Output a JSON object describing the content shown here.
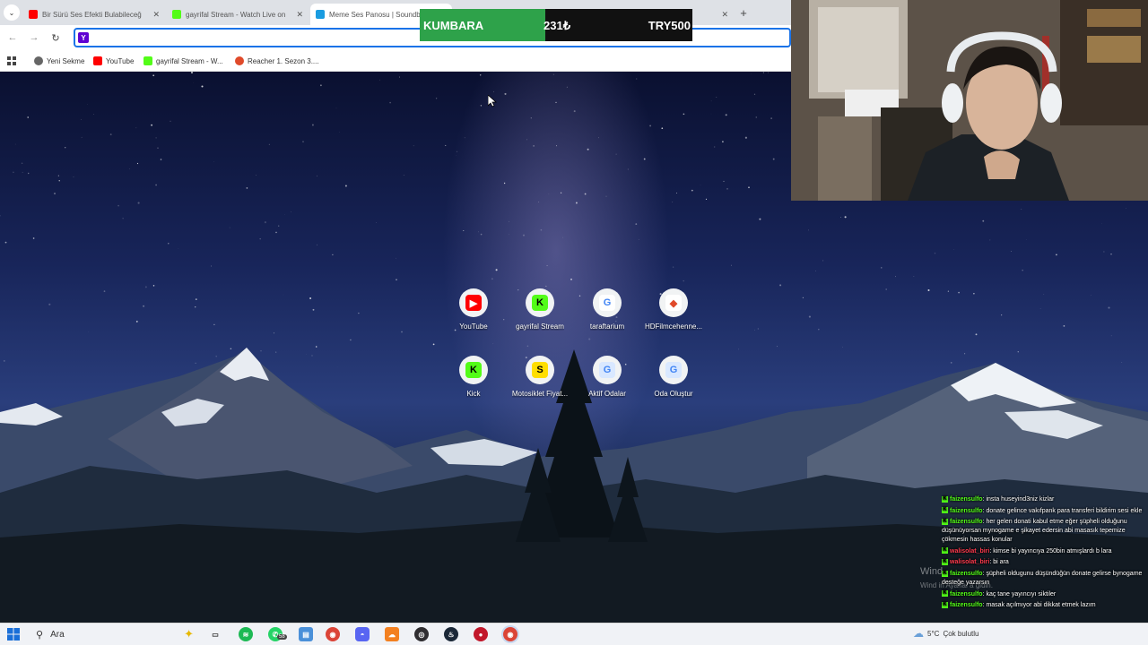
{
  "browser": {
    "tabs": [
      {
        "title": "Bir Sürü Ses Efekti Bulabileceğ",
        "favicon": "youtube-icon",
        "color": "#ff0000"
      },
      {
        "title": "gayrifal Stream - Watch Live on",
        "favicon": "kick-icon",
        "color": "#53fc18"
      },
      {
        "title": "Meme Ses Panosu | Soundbo",
        "favicon": "soundboard-icon",
        "color": "#1a9ce0"
      },
      {
        "title": "",
        "favicon": "blank-tab-icon",
        "color": "#bbbbbb"
      },
      {
        "title": "",
        "favicon": "blank-tab-icon",
        "color": "#ff6666"
      }
    ],
    "new_tab_symbol": "+",
    "omnibox_value": "",
    "bookmarks": [
      {
        "label": "Yeni Sekme",
        "favicon": "chrome-icon",
        "color": "#666666"
      },
      {
        "label": "YouTube",
        "favicon": "youtube-icon",
        "color": "#ff0000"
      },
      {
        "label": "gayrifal Stream - W...",
        "favicon": "kick-icon",
        "color": "#53fc18"
      },
      {
        "label": "Reacher 1. Sezon 3....",
        "favicon": "hdfilm-icon",
        "color": "#e04a2a"
      }
    ]
  },
  "kumbara": {
    "label": "KUMBARA",
    "amount": "231₺",
    "goal": "TRY500",
    "progress_fraction": 0.462,
    "fill_color": "#2ea24a"
  },
  "shortcuts": [
    {
      "label": "YouTube",
      "icon": "youtube-icon",
      "glyph": "▶",
      "bg": "#ff0000",
      "fg": "#ffffff"
    },
    {
      "label": "gayrifal Stream",
      "icon": "kick-icon",
      "glyph": "K",
      "bg": "#53fc18",
      "fg": "#000000"
    },
    {
      "label": "taraftarium",
      "icon": "google-icon",
      "glyph": "G",
      "bg": "#ffffff",
      "fg": "#4285f4"
    },
    {
      "label": "HDFilmcehenne...",
      "icon": "hdfilm-icon",
      "glyph": "◆",
      "bg": "#ffffff",
      "fg": "#e04a2a"
    },
    {
      "label": "Kick",
      "icon": "kick-icon",
      "glyph": "K",
      "bg": "#53fc18",
      "fg": "#000000"
    },
    {
      "label": "Motosiklet Fiyat...",
      "icon": "s-icon",
      "glyph": "S",
      "bg": "#ffde00",
      "fg": "#000000"
    },
    {
      "label": "Aktif Odalar",
      "icon": "google-icon",
      "glyph": "G",
      "bg": "#d9e8ff",
      "fg": "#4285f4"
    },
    {
      "label": "Oda Oluştur",
      "icon": "google-icon",
      "glyph": "G",
      "bg": "#d9e8ff",
      "fg": "#4285f4"
    }
  ],
  "chat": [
    {
      "user": "faizensulfo",
      "user_color": "green",
      "text": ": insta huseyind3niz kizlar"
    },
    {
      "user": "faizensulfo",
      "user_color": "green",
      "text": ": donate gelince vakıfpank para transferi bildirim sesi ekle"
    },
    {
      "user": "faizensulfo",
      "user_color": "green",
      "text": ": her gelen donati kabul etme eğer şüpheli olduğunu düşünüyorsan mynogame e şikayet edersin abi masasık tepemize çökmesin hassas konular"
    },
    {
      "user": "walisolat_biri",
      "user_color": "red",
      "text": ": kimse bi yayıncıya 250bin atmışlardı b lara"
    },
    {
      "user": "walisolat_biri",
      "user_color": "red",
      "text": ": bi ara"
    },
    {
      "user": "faizensulfo",
      "user_color": "green",
      "text": ": şüpheli oldugunu düşündüğün donate gelirse bynogame desteğe yazarsın"
    },
    {
      "user": "faizensulfo",
      "user_color": "green",
      "text": ": kaç tane yayıncıyı siktiler"
    },
    {
      "user": "faizensulfo",
      "user_color": "green",
      "text": ": masak açılmıyor abi dikkat etmek lazım"
    }
  ],
  "windows_watermark": {
    "line1": "Wind",
    "line2": "Wind                     in Ayarlar'a gidin."
  },
  "taskbar": {
    "search_placeholder": "Ara",
    "weather_temp": "5°C",
    "weather_desc": "Çok bulutlu",
    "apps": [
      "task-view-icon",
      "spotify-icon",
      "whatsapp-icon",
      "files-icon",
      "chrome-icon",
      "discord-icon",
      "cloud-app-icon",
      "obs-icon",
      "steam-icon",
      "app-icon",
      "chrome-icon"
    ],
    "whatsapp_badge": "58"
  }
}
